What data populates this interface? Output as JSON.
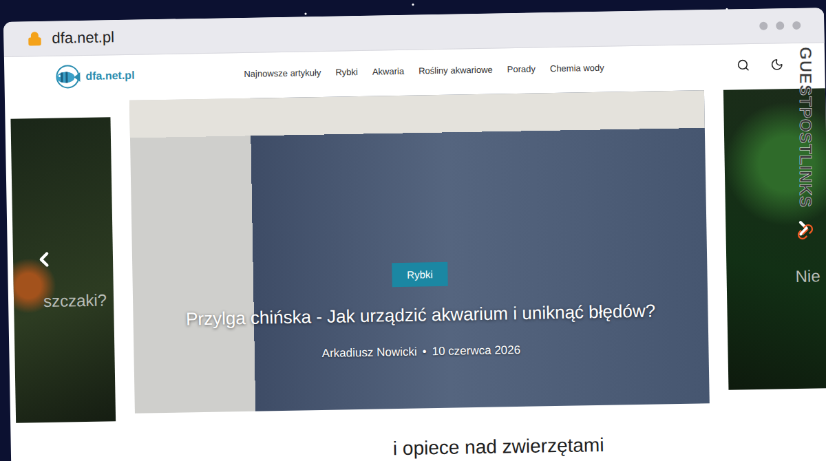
{
  "browser": {
    "url": "dfa.net.pl"
  },
  "header": {
    "logo": "dfa.net.pl",
    "nav": [
      {
        "label": "Najnowsze artykuły"
      },
      {
        "label": "Rybki"
      },
      {
        "label": "Akwaria"
      },
      {
        "label": "Rośliny akwariowe"
      },
      {
        "label": "Porady"
      },
      {
        "label": "Chemia wody"
      }
    ]
  },
  "carousel": {
    "slides": [
      {
        "kind": "side",
        "title": "szczaki?"
      },
      {
        "kind": "main",
        "category": "Rybki",
        "title": "Przylga chińska - Jak urządzić akwarium i uniknąć błędów?",
        "author": "Arkadiusz Nowicki",
        "separator": "•",
        "date": "10 czerwca 2026"
      },
      {
        "kind": "side",
        "title": "Nie"
      }
    ]
  },
  "section_heading": "i opiece nad zwierzętami",
  "watermark": "GUESTPOSTLINKS"
}
